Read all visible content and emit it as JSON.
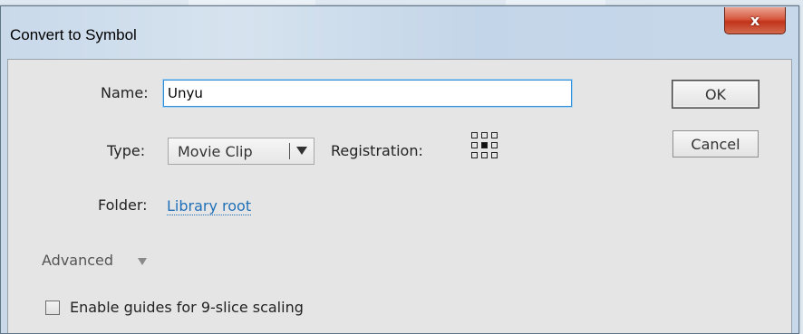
{
  "dialog": {
    "title": "Convert to Symbol",
    "close_label": "x"
  },
  "form": {
    "name_label": "Name:",
    "name_value": "Unyu",
    "type_label": "Type:",
    "type_value": "Movie Clip",
    "registration_label": "Registration:",
    "registration_selected": "center",
    "folder_label": "Folder:",
    "folder_value": "Library root",
    "advanced_label": "Advanced",
    "slice_label": "Enable guides for 9-slice scaling",
    "slice_checked": false
  },
  "buttons": {
    "ok": "OK",
    "cancel": "Cancel"
  },
  "icons": {
    "close": "close-icon",
    "type_dropdown": "dropdown-arrow-icon",
    "advanced_toggle": "triangle-down-icon",
    "registration": "registration-grid-icon"
  }
}
